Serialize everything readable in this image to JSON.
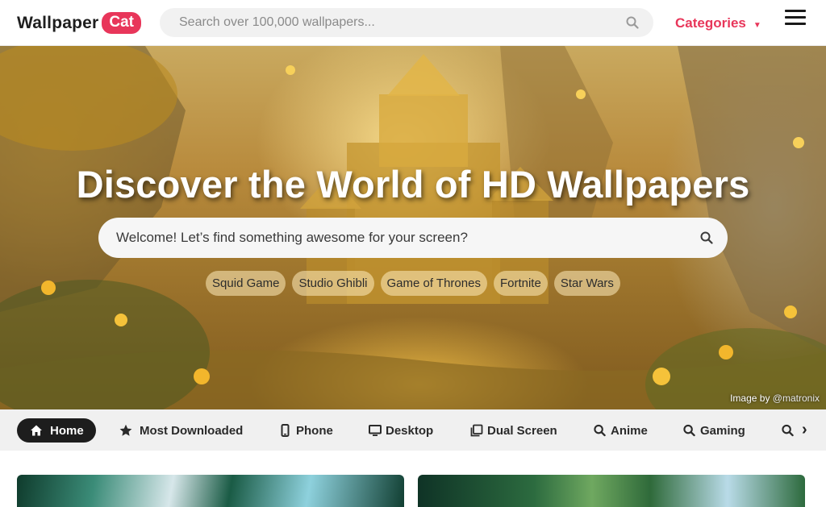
{
  "header": {
    "logo_text": "Wallpaper",
    "logo_badge": "Cat",
    "search_placeholder": "Search over 100,000 wallpapers...",
    "search_icon": "search-icon",
    "categories_label": "Categories",
    "categories_caret": "▼",
    "menu_icon": "hamburger-menu-icon"
  },
  "hero": {
    "title": "Discover the World of HD Wallpapers",
    "search_placeholder": "Welcome! Let’s find something awesome for your screen?",
    "tags": [
      "Squid Game",
      "Studio Ghibli",
      "Game of Thrones",
      "Fortnite",
      "Star Wars"
    ],
    "credit_prefix": "Image by",
    "credit_handle": "@matronix"
  },
  "nav": {
    "items": [
      {
        "label": "Home",
        "icon": "home-icon",
        "active": true
      },
      {
        "label": "Most Downloaded",
        "icon": "star-icon"
      },
      {
        "label": "Phone",
        "icon": "phone-icon"
      },
      {
        "label": "Desktop",
        "icon": "desktop-icon"
      },
      {
        "label": "Dual Screen",
        "icon": "dual-screen-icon"
      },
      {
        "label": "Anime",
        "icon": "search-icon"
      },
      {
        "label": "Gaming",
        "icon": "search-icon"
      },
      {
        "label": "",
        "icon": "search-icon"
      }
    ],
    "next_arrow": "›"
  },
  "colors": {
    "brand": "#e8365a",
    "nav_active_bg": "#1d1d1d",
    "nav_bg": "#f0f0f0"
  }
}
